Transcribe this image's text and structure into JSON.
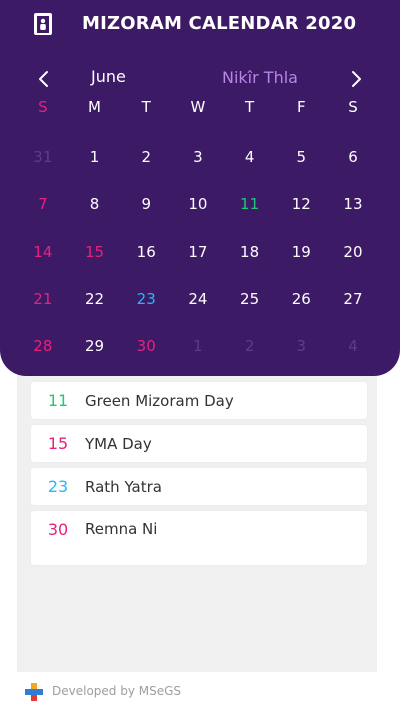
{
  "app": {
    "title": "MIZORAM CALENDAR 2020",
    "icon": "calendar-person-icon",
    "header_color": "#3d1a66"
  },
  "calendar": {
    "month": "June",
    "month_local": "Nikîr Thla",
    "prev_icon": "chevron-left-icon",
    "next_icon": "chevron-right-icon",
    "weekdays": [
      "S",
      "M",
      "T",
      "W",
      "T",
      "F",
      "S"
    ],
    "weeks": [
      [
        {
          "d": "31",
          "s": "muted"
        },
        {
          "d": "1",
          "s": ""
        },
        {
          "d": "2",
          "s": ""
        },
        {
          "d": "3",
          "s": ""
        },
        {
          "d": "4",
          "s": ""
        },
        {
          "d": "5",
          "s": ""
        },
        {
          "d": "6",
          "s": ""
        }
      ],
      [
        {
          "d": "7",
          "s": "sunday"
        },
        {
          "d": "8",
          "s": ""
        },
        {
          "d": "9",
          "s": ""
        },
        {
          "d": "10",
          "s": ""
        },
        {
          "d": "11",
          "s": "green"
        },
        {
          "d": "12",
          "s": ""
        },
        {
          "d": "13",
          "s": ""
        }
      ],
      [
        {
          "d": "14",
          "s": "sunday"
        },
        {
          "d": "15",
          "s": "holiday"
        },
        {
          "d": "16",
          "s": ""
        },
        {
          "d": "17",
          "s": ""
        },
        {
          "d": "18",
          "s": ""
        },
        {
          "d": "19",
          "s": ""
        },
        {
          "d": "20",
          "s": ""
        }
      ],
      [
        {
          "d": "21",
          "s": "sunday"
        },
        {
          "d": "22",
          "s": ""
        },
        {
          "d": "23",
          "s": "blue"
        },
        {
          "d": "24",
          "s": ""
        },
        {
          "d": "25",
          "s": ""
        },
        {
          "d": "26",
          "s": ""
        },
        {
          "d": "27",
          "s": ""
        }
      ],
      [
        {
          "d": "28",
          "s": "sunday"
        },
        {
          "d": "29",
          "s": ""
        },
        {
          "d": "30",
          "s": "holiday"
        },
        {
          "d": "1",
          "s": "muted"
        },
        {
          "d": "2",
          "s": "muted"
        },
        {
          "d": "3",
          "s": "muted"
        },
        {
          "d": "4",
          "s": "muted"
        }
      ]
    ],
    "colors": {
      "sunday": "#e6217e",
      "holiday": "#e6217e",
      "green": "#1ec97a",
      "blue": "#29b6f6",
      "muted": "#5e3d87"
    }
  },
  "events": [
    {
      "date": "11",
      "name": "Green Mizoram Day",
      "color": "#1ec97a"
    },
    {
      "date": "15",
      "name": "YMA Day",
      "color": "#e6217e"
    },
    {
      "date": "23",
      "name": "Rath Yatra",
      "color": "#29b6f6"
    },
    {
      "date": "30",
      "name": "Remna Ni",
      "color": "#e6217e"
    }
  ],
  "footer": {
    "text": "Developed by MSeGS",
    "logo": "msegs-logo-icon"
  }
}
